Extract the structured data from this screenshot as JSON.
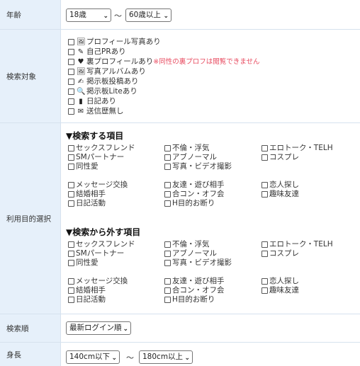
{
  "age": {
    "label": "年齢",
    "from": "18歳",
    "sep": "～",
    "to": "60歳以上"
  },
  "target": {
    "label": "検索対象",
    "items": [
      {
        "icon": "picture-icon",
        "glyph": "🖼",
        "text": "プロフィール写真あり"
      },
      {
        "icon": "pencil-icon",
        "glyph": "✎",
        "text": "自己PRあり"
      },
      {
        "icon": "heart-icon",
        "glyph": "♥",
        "text": "裏プロフィールあり"
      },
      {
        "icon": "picture-icon",
        "glyph": "🖼",
        "text": "写真アルバムあり"
      },
      {
        "icon": "edit-icon",
        "glyph": "✍",
        "text": "掲示板投稿あり"
      },
      {
        "icon": "search-icon",
        "glyph": "🔍",
        "text": "掲示板Liteあり"
      },
      {
        "icon": "book-icon",
        "glyph": "▮",
        "text": "日記あり"
      },
      {
        "icon": "envelope-icon",
        "glyph": "✉",
        "text": "送信歴無し"
      }
    ],
    "warning": "※同性の裏プロフは閲覧できません"
  },
  "purpose": {
    "label": "利用目的選択",
    "include_title": "▼検索する項目",
    "exclude_title": "▼検索から外す項目",
    "groupA": [
      [
        "セックスフレンド",
        "不倫・浮気",
        "エロトーク・TELH"
      ],
      [
        "SMパートナー",
        "アブノーマル",
        "コスプレ"
      ],
      [
        "同性愛",
        "写真・ビデオ撮影",
        ""
      ]
    ],
    "groupB": [
      [
        "メッセージ交換",
        "友達・遊び相手",
        "恋人探し"
      ],
      [
        "結婚相手",
        "合コン・オフ会",
        "趣味友達"
      ],
      [
        "日記活動",
        "H目的お断り",
        ""
      ]
    ]
  },
  "order": {
    "label": "検索順",
    "value": "最新ログイン順"
  },
  "height": {
    "label": "身長",
    "from": "140cm以下",
    "sep": "～",
    "to": "180cm以上"
  }
}
